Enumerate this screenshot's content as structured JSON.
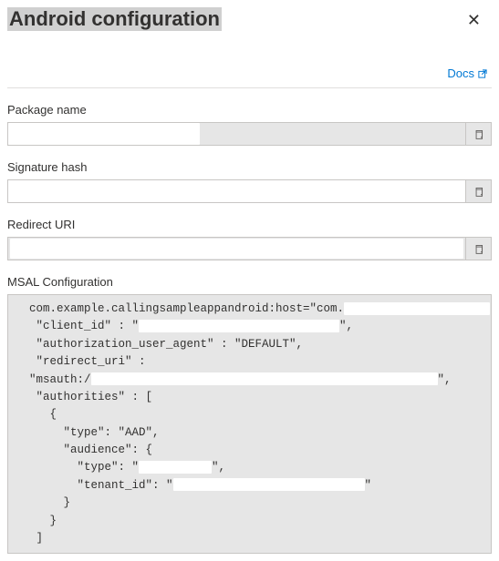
{
  "header": {
    "title": "Android configuration",
    "close_label": "✕"
  },
  "links": {
    "docs_label": "Docs"
  },
  "fields": {
    "package_name": {
      "label": "Package name",
      "value": ""
    },
    "signature_hash": {
      "label": "Signature hash",
      "value": ""
    },
    "redirect_uri": {
      "label": "Redirect URI",
      "value": ""
    },
    "msal_config": {
      "label": "MSAL Configuration"
    }
  },
  "msal": {
    "line1_prefix": "  com.example.callingsampleappandroid:host=\"com.",
    "line1_suffix": "\"{",
    "client_id_key": "   \"client_id\" : \"",
    "client_id_end": "\",",
    "auth_agent_line": "   \"authorization_user_agent\" : \"DEFAULT\",",
    "redirect_key": "   \"redirect_uri\" :",
    "msauth_prefix": "  \"msauth:/",
    "msauth_suffix": "\",",
    "authorities_key": "   \"authorities\" : [",
    "brace_open": "     {",
    "type_aad": "       \"type\": \"AAD\",",
    "audience_key": "       \"audience\": {",
    "audience_type_key": "         \"type\": \"",
    "audience_type_end": "\",",
    "tenant_key": "         \"tenant_id\": \"",
    "tenant_end": "\"",
    "brace_close1": "       }",
    "brace_close2": "     }",
    "bracket_close": "   ]"
  }
}
